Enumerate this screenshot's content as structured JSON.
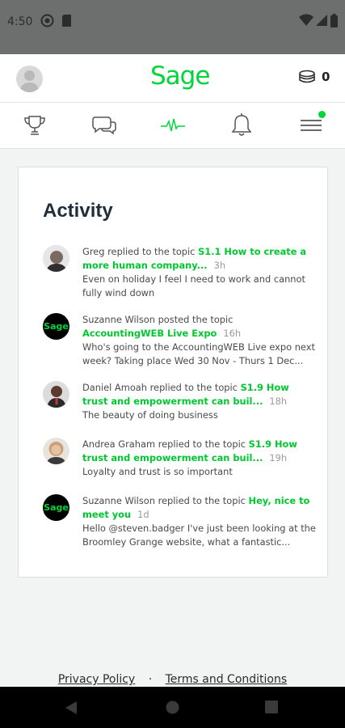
{
  "status": {
    "time": "4:50",
    "icons": [
      "record-icon",
      "sim-icon",
      "wifi-icon",
      "signal-icon",
      "battery-icon"
    ]
  },
  "topbar": {
    "logo": "Sage",
    "coins_count": "0"
  },
  "nav": {
    "items": [
      "trophy-icon",
      "chat-icon",
      "activity-icon",
      "bell-icon",
      "menu-icon"
    ],
    "active": "activity-icon"
  },
  "activity": {
    "title": "Activity",
    "items": [
      {
        "actor": "Greg",
        "action": "replied to the topic",
        "topic": "S1.1 How to create a more human company...",
        "ago": "3h",
        "body": "Even on holiday I feel I need to work and cannot fully wind down"
      },
      {
        "actor": "Suzanne Wilson",
        "action": "posted the topic",
        "topic": "AccountingWEB Live Expo",
        "ago": "16h",
        "body": "Who's going to the AccountingWEB Live expo next week? Taking place Wed 30 Nov - Thurs 1 Dec...",
        "avatar_text": "Sage"
      },
      {
        "actor": "Daniel Amoah",
        "action": "replied to the topic",
        "topic": "S1.9 How trust and empowerment can buil...",
        "ago": "18h",
        "body": "The beauty of doing business"
      },
      {
        "actor": "Andrea Graham",
        "action": "replied to the topic",
        "topic": "S1.9 How trust and empowerment can buil...",
        "ago": "19h",
        "body": "Loyalty and trust is so important"
      },
      {
        "actor": "Suzanne Wilson",
        "action": "replied to the topic",
        "topic": "Hey, nice to meet you",
        "ago": "1d",
        "body": "Hello @steven.badger I've just been looking at the Broomley Grange website, what a fantastic...",
        "avatar_text": "Sage"
      }
    ]
  },
  "footer": {
    "privacy": "Privacy Policy",
    "separator": "·",
    "terms": "Terms and Conditions"
  },
  "colors": {
    "brand": "#00d639",
    "topic": "#00c82f",
    "title": "#1f2e3a"
  }
}
